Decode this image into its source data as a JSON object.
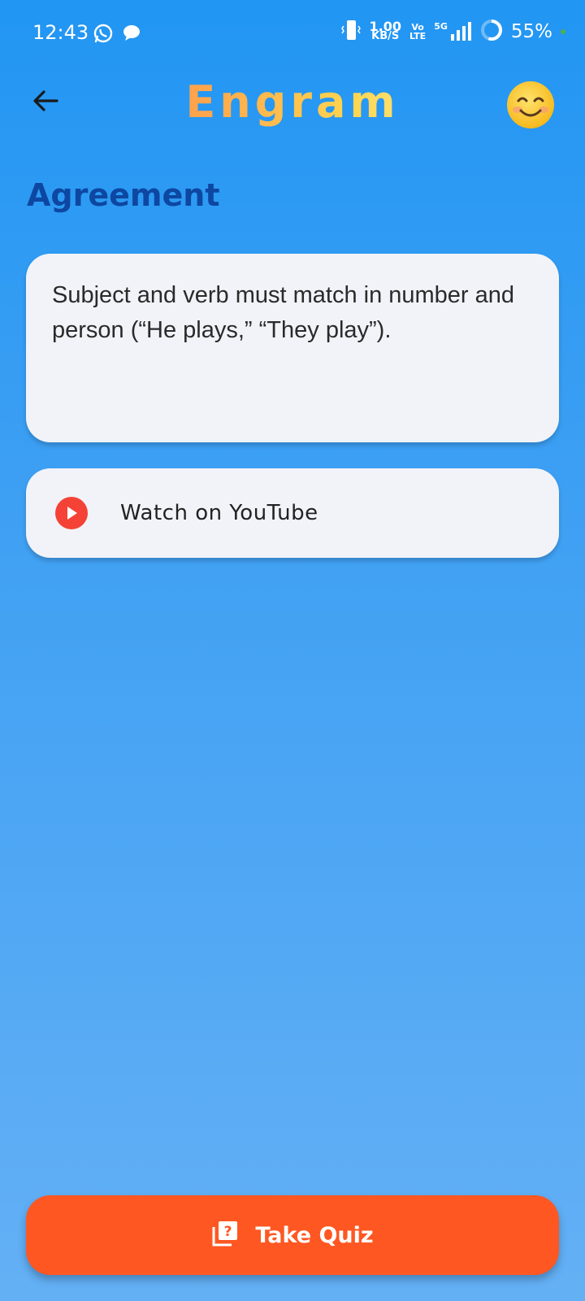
{
  "status_bar": {
    "time": "12:43",
    "net_speed_value": "1.00",
    "net_speed_unit": "KB/S",
    "volte_top": "Vo",
    "volte_bottom": "LTE",
    "network": "5G",
    "battery": "55%"
  },
  "header": {
    "title": "Engram",
    "mood_emoji": "😊",
    "back_icon": "arrow-left-icon"
  },
  "topic": {
    "title": "Agreement",
    "description": "Subject and verb must match in number and person (“He plays,” “They play”)."
  },
  "video": {
    "label": "Watch on YouTube",
    "icon": "play-icon",
    "accent": "#F44336"
  },
  "quiz": {
    "label": "Take Quiz",
    "icon": "quiz-icon",
    "color": "#FF5722"
  },
  "colors": {
    "background_top": "#2196F3",
    "background_bottom": "#64B0F5",
    "topic_title": "#0D47A1",
    "card": "#F1F3F8"
  }
}
